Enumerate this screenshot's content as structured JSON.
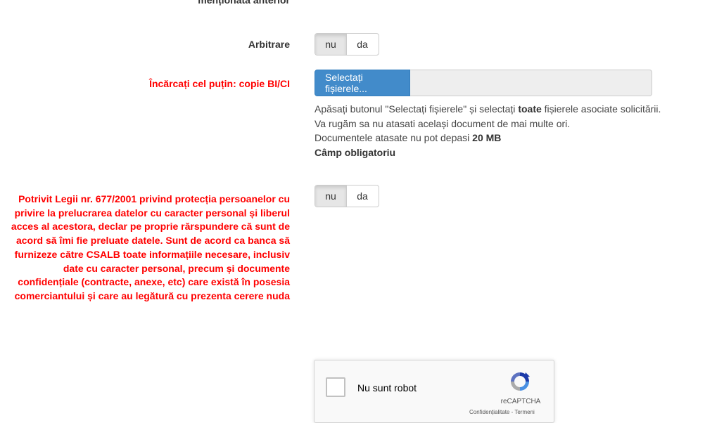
{
  "form": {
    "prev_label": "menționată anterior",
    "arbitration": {
      "label": "Arbitrare",
      "options": [
        "nu",
        "da"
      ],
      "selected": "nu"
    },
    "upload": {
      "label": "Încărcați cel puțin: copie BI/CI",
      "button_label": "Selectați fișierele...",
      "help_line1_pre": "Apăsați butonul \"Selectați fișierele\" și selectați ",
      "help_line1_bold": "toate",
      "help_line1_post": " fișierele asociate solicitării.",
      "help_line2": "Va rugăm sa nu atasati același document de mai multe ori.",
      "help_line3_pre": "Documentele atasate nu pot depasi ",
      "help_line3_bold": "20 MB",
      "help_line4": "Câmp obligatoriu"
    },
    "consent": {
      "label": "Potrivit Legii nr. 677/2001 privind protecția persoanelor cu privire la prelucrarea datelor cu caracter personal și liberul acces al acestora, declar pe proprie rărspundere că sunt de acord să îmi fie preluate datele. Sunt de acord ca banca să furnizeze către CSALB toate informațiile necesare, inclusiv date cu caracter personal, precum și documente confidențiale (contracte, anexe, etc) care există în posesia comerciantului și care au legătură cu prezenta cerere nuda",
      "options": [
        "nu",
        "da"
      ],
      "selected": "nu"
    }
  },
  "captcha": {
    "label": "Nu sunt robot",
    "brand": "reCAPTCHA",
    "links": "Confidențialitate - Termeni"
  },
  "colors": {
    "required_label": "#ff0000",
    "primary_button": "#428bca",
    "toggle_active": "#e6e6e6"
  }
}
